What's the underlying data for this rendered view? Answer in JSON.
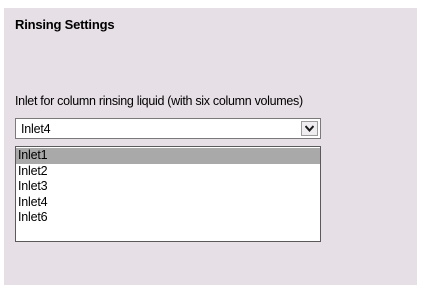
{
  "section": {
    "title": "Rinsing Settings"
  },
  "inlet_field": {
    "label": "Inlet for column rinsing liquid (with six column volumes)",
    "selected_value": "Inlet4",
    "options": [
      "Inlet1",
      "Inlet2",
      "Inlet3",
      "Inlet4",
      "Inlet6"
    ],
    "highlighted_option": "Inlet1"
  },
  "icons": {
    "dropdown_arrow": "chevron-down-icon"
  }
}
